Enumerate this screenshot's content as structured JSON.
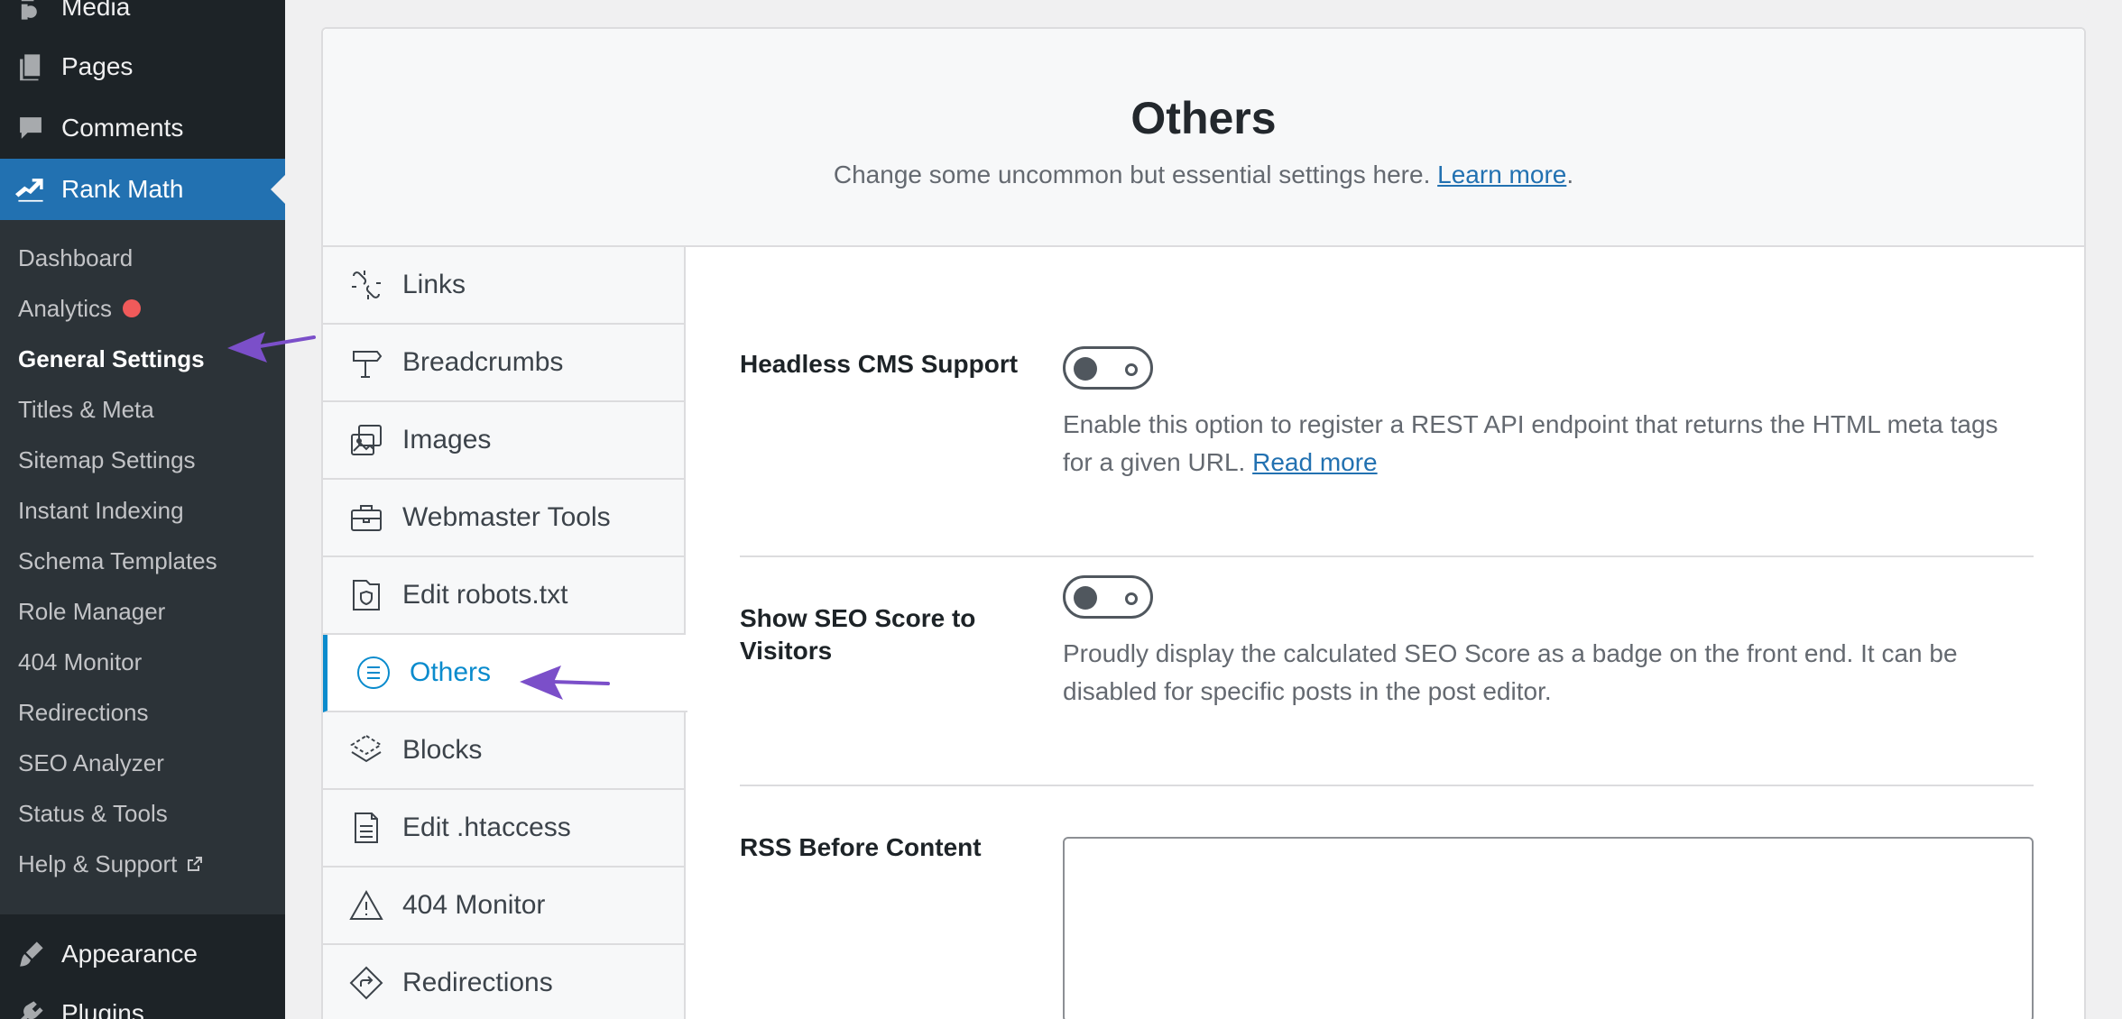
{
  "sidebar": {
    "top_items": [
      {
        "label": "Media"
      },
      {
        "label": "Pages"
      },
      {
        "label": "Comments"
      },
      {
        "label": "Rank Math"
      }
    ],
    "submenu": [
      {
        "label": "Dashboard"
      },
      {
        "label": "Analytics"
      },
      {
        "label": "General Settings"
      },
      {
        "label": "Titles & Meta"
      },
      {
        "label": "Sitemap Settings"
      },
      {
        "label": "Instant Indexing"
      },
      {
        "label": "Schema Templates"
      },
      {
        "label": "Role Manager"
      },
      {
        "label": "404 Monitor"
      },
      {
        "label": "Redirections"
      },
      {
        "label": "SEO Analyzer"
      },
      {
        "label": "Status & Tools"
      },
      {
        "label": "Help & Support"
      }
    ],
    "bottom_items": [
      {
        "label": "Appearance"
      },
      {
        "label": "Plugins"
      }
    ]
  },
  "header": {
    "title": "Others",
    "description": "Change some uncommon but essential settings here.",
    "learn_more": "Learn more",
    "period": "."
  },
  "tabs": [
    {
      "label": "Links",
      "icon": "links-icon"
    },
    {
      "label": "Breadcrumbs",
      "icon": "signpost-icon"
    },
    {
      "label": "Images",
      "icon": "images-icon"
    },
    {
      "label": "Webmaster Tools",
      "icon": "toolbox-icon"
    },
    {
      "label": "Edit robots.txt",
      "icon": "robots-file-icon"
    },
    {
      "label": "Others",
      "icon": "list-circle-icon"
    },
    {
      "label": "Blocks",
      "icon": "blocks-icon"
    },
    {
      "label": "Edit .htaccess",
      "icon": "document-icon"
    },
    {
      "label": "404 Monitor",
      "icon": "warning-icon"
    },
    {
      "label": "Redirections",
      "icon": "redirect-icon"
    }
  ],
  "fields": {
    "headless": {
      "label": "Headless CMS Support",
      "enabled": false,
      "description": "Enable this option to register a REST API endpoint that returns the HTML meta tags for a given URL.",
      "read_more": "Read more"
    },
    "seo_score": {
      "label": "Show SEO Score to Visitors",
      "enabled": false,
      "description": "Proudly display the calculated SEO Score as a badge on the front end. It can be disabled for specific posts in the post editor."
    },
    "rss_before": {
      "label": "RSS Before Content",
      "value": ""
    }
  },
  "colors": {
    "sidebar_bg": "#1d2327",
    "submenu_bg": "#2c3338",
    "wp_blue": "#2271b1",
    "active_tab": "#0a8bcd",
    "annotation_arrow": "#7b4fc9",
    "notification_dot": "#f05a5a"
  }
}
